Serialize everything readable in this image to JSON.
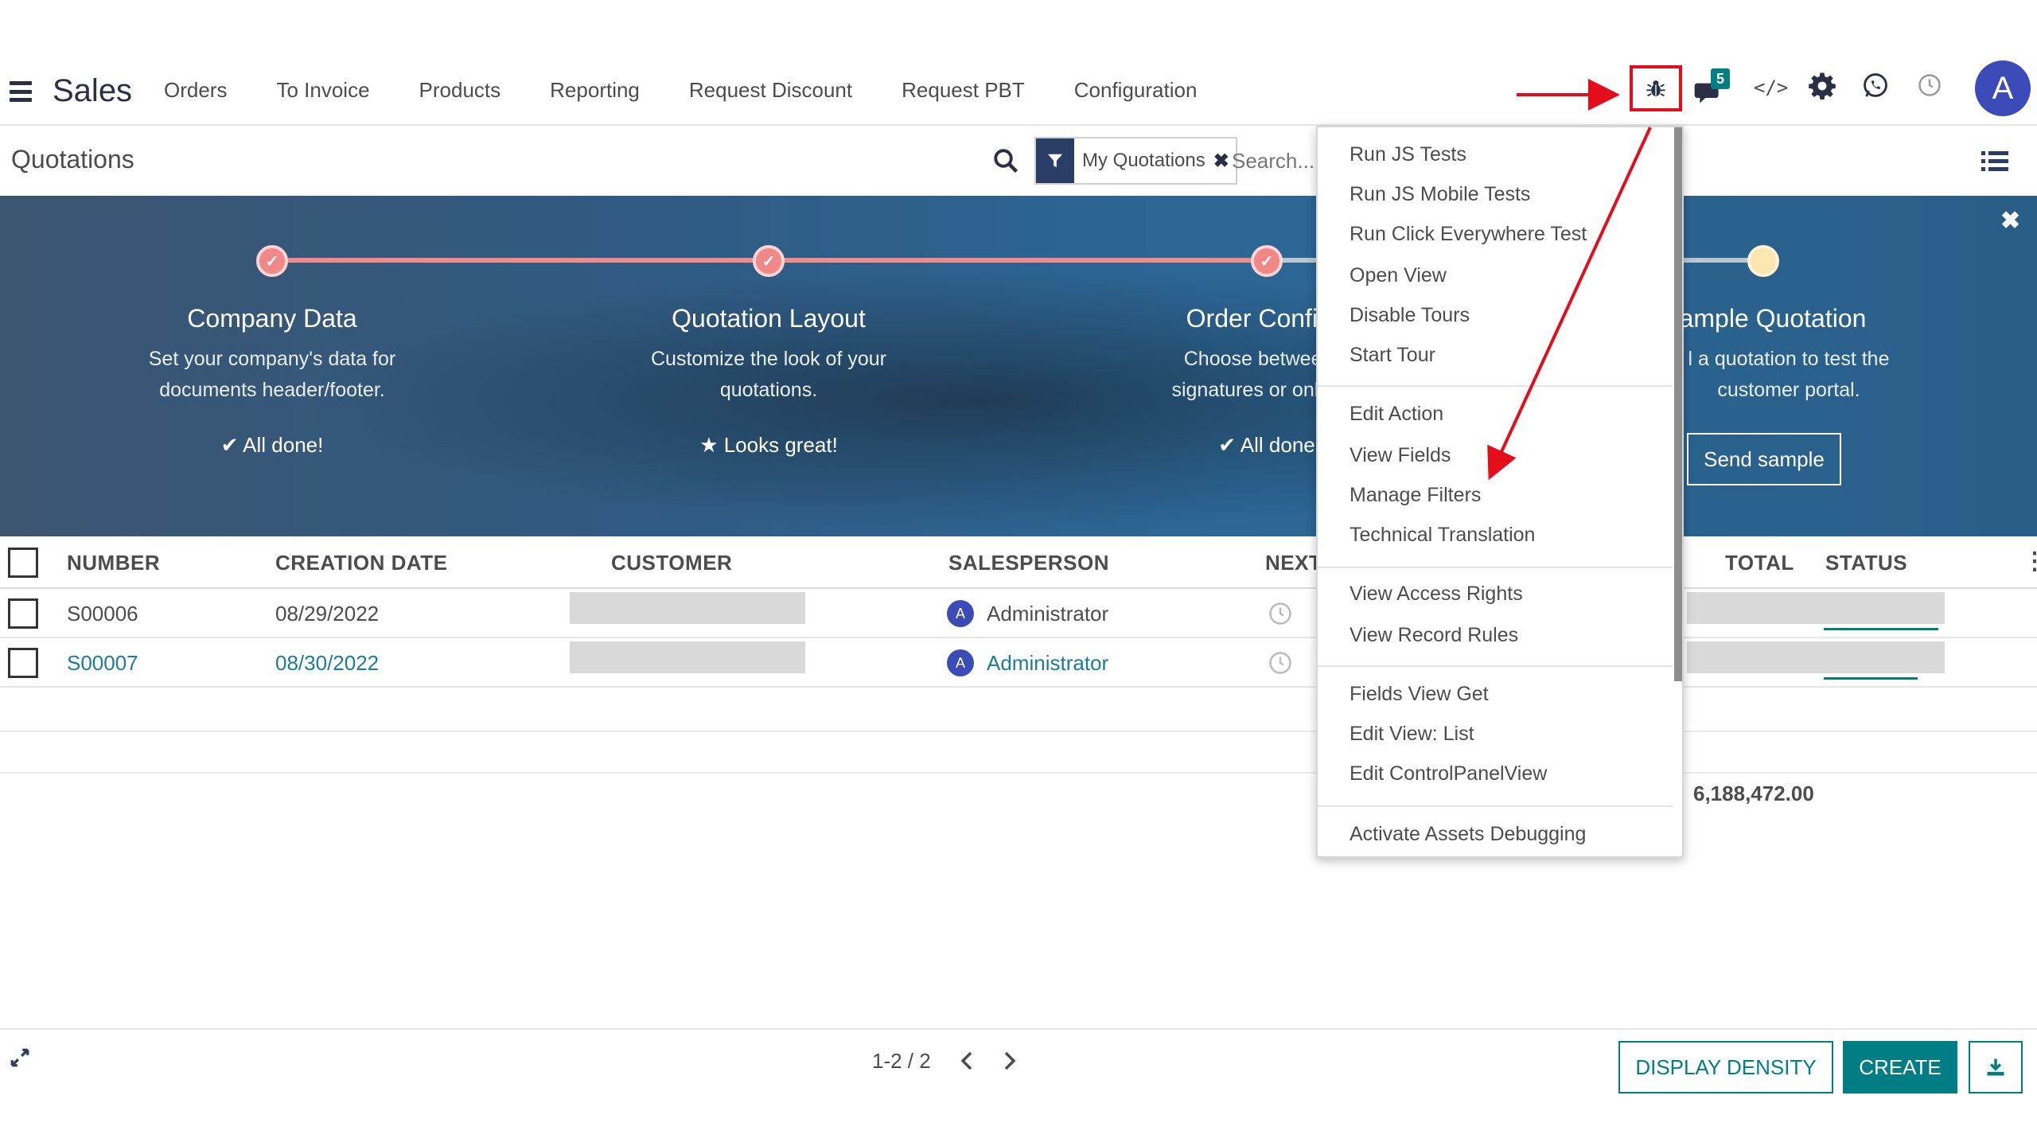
{
  "nav": {
    "app_title": "Sales",
    "menu": [
      "Orders",
      "To Invoice",
      "Products",
      "Reporting",
      "Request Discount",
      "Request PBT",
      "Configuration"
    ],
    "chat_badge": "5",
    "code_icon_text": "</>",
    "avatar_letter": "A"
  },
  "control_panel": {
    "title": "Quotations",
    "facet_label": "My Quotations",
    "search_placeholder": "Search..."
  },
  "onboarding": {
    "steps": [
      {
        "title": "Company Data",
        "desc1": "Set your company's data for",
        "desc2": "documents header/footer.",
        "status": "✔ All done!"
      },
      {
        "title": "Quotation Layout",
        "desc1": "Customize the look of your",
        "desc2": "quotations.",
        "status": "★ Looks great!"
      },
      {
        "title": "Order Confirm",
        "desc1": "Choose between e",
        "desc2": "signatures or online p",
        "status": "✔ All done"
      },
      {
        "title": "ample Quotation",
        "desc1": "l a quotation to test the",
        "desc2": "customer portal.",
        "status": ""
      }
    ],
    "send_sample_label": "Send sample",
    "close_glyph": "✖"
  },
  "table": {
    "headers": {
      "number": "NUMBER",
      "creation_date": "CREATION DATE",
      "customer": "CUSTOMER",
      "salesperson": "SALESPERSON",
      "next": "NEXT",
      "total": "TOTAL",
      "status": "STATUS"
    },
    "rows": [
      {
        "number": "S00006",
        "date": "08/29/2022",
        "avatar": "A",
        "salesperson": "Administrator"
      },
      {
        "number": "S00007",
        "date": "08/30/2022",
        "avatar": "A",
        "salesperson": "Administrator"
      }
    ],
    "total_sum": "6,188,472.00"
  },
  "footer": {
    "pager": "1-2 / 2",
    "display_density_label": "DISPLAY DENSITY",
    "create_label": "CREATE"
  },
  "debug_menu": {
    "group1": [
      "Run JS Tests",
      "Run JS Mobile Tests",
      "Run Click Everywhere Test",
      "Open View",
      "Disable Tours",
      "Start Tour"
    ],
    "group2": [
      "Edit Action",
      "View Fields",
      "Manage Filters",
      "Technical Translation"
    ],
    "group3": [
      "View Access Rights",
      "View Record Rules"
    ],
    "group4": [
      "Fields View Get",
      "Edit View: List",
      "Edit ControlPanelView"
    ],
    "group5": [
      "Activate Assets Debugging"
    ]
  },
  "colors": {
    "accent": "#017e84",
    "annotation": "#e30d1b",
    "avatar": "#3b4cb8",
    "link": "#1b7a9d"
  },
  "icons": [
    "hamburger-icon",
    "bug-icon",
    "chat-icon",
    "code-icon",
    "gear-icon",
    "whatsapp-icon",
    "clock-icon",
    "search-icon",
    "filter-icon",
    "list-view-icon",
    "expand-icon",
    "chevron-left-icon",
    "chevron-right-icon",
    "download-icon"
  ]
}
